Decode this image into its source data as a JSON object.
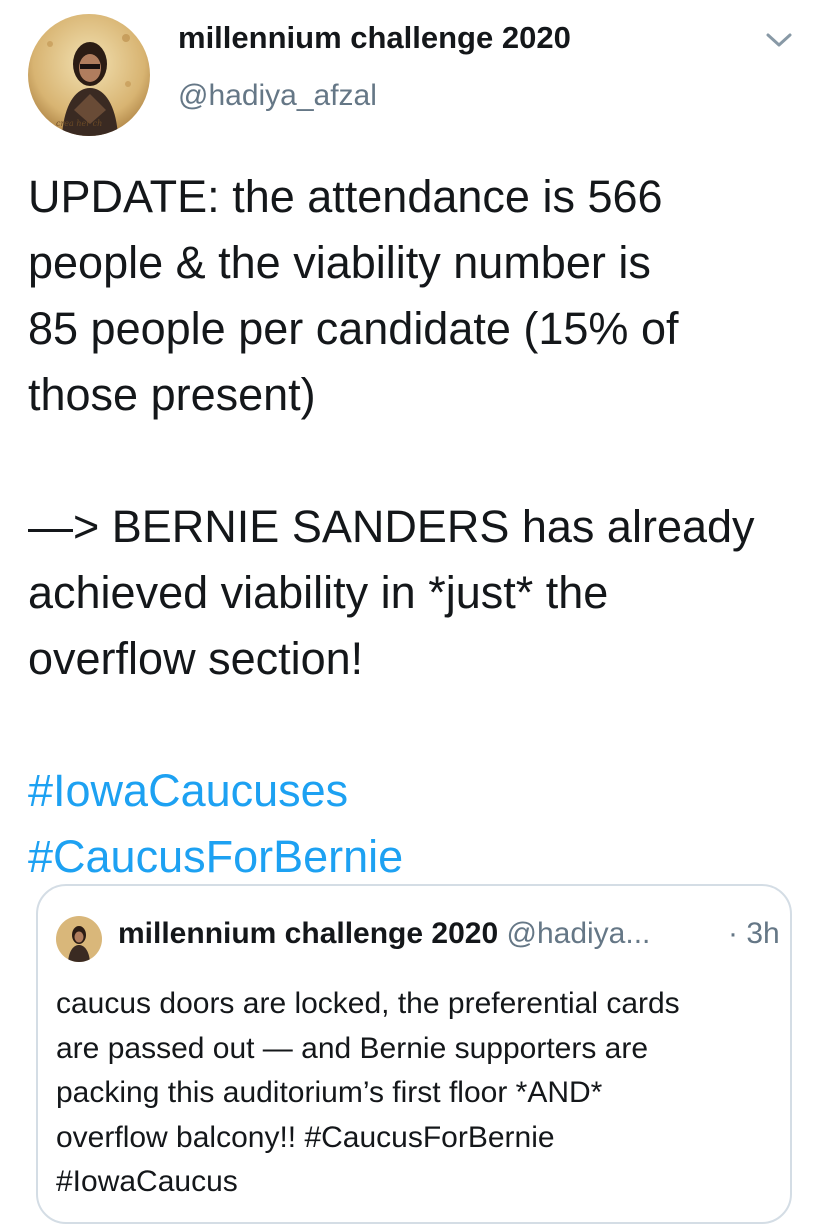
{
  "tweet": {
    "author": {
      "display_name": "millennium challenge 2020",
      "handle": "@hadiya_afzal",
      "avatar_icon": "profile-photo-icon"
    },
    "menu_icon": "chevron-down-icon",
    "text_lines": {
      "l1": "UPDATE: the attendance is 566",
      "l2": "people & the viability number is",
      "l3": "85 people per candidate (15% of",
      "l4": "those present)",
      "l5": "—> BERNIE SANDERS has already",
      "l6": "achieved viability in *just* the",
      "l7": "overflow section!"
    },
    "hashtags": [
      "#IowaCaucuses",
      "#CaucusForBernie"
    ]
  },
  "quoted_tweet": {
    "display_name": "millennium challenge 2020",
    "handle": "@hadiya...",
    "time": "· 3h",
    "text_lines": {
      "l1": "caucus doors are locked, the preferential cards",
      "l2": "are passed out — and Bernie supporters are",
      "l3": "packing this auditorium’s first floor *AND*",
      "l4": "overflow balcony!! #CaucusForBernie",
      "l5": "#IowaCaucus"
    }
  },
  "colors": {
    "link": "#1da1f2",
    "text": "#14171a",
    "secondary": "#657786",
    "border": "#d4dde5"
  }
}
